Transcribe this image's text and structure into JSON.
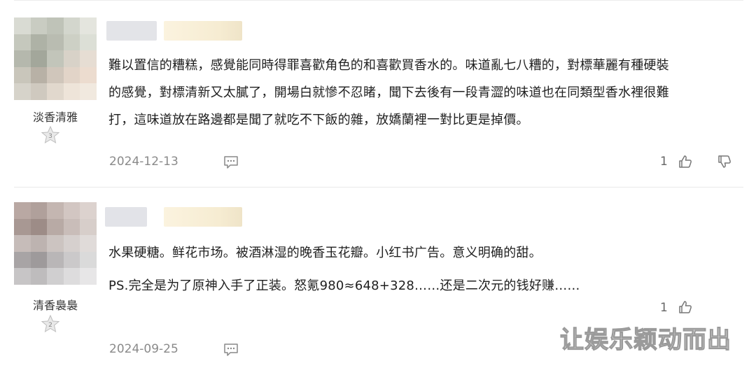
{
  "comments": [
    {
      "username": "淡香清雅",
      "level": "3",
      "text_lines": [
        "難以置信的糟糕，感覺能同時得罪喜歡角色的和喜歡買香水的。味道亂七八糟的，對標華麗有種硬裝",
        "的感覺，對標清新又太膩了，開場白就慘不忍睹，聞下去後有一段青澀的味道也在同類型香水裡很難",
        "打，這味道放在路邊都是聞了就吃不下飯的雜，放嬌蘭裡一對比更是掉價。"
      ],
      "date": "2024-12-13",
      "likes": "1"
    },
    {
      "username": "清香裊裊",
      "level": "2",
      "text_lines": [
        "水果硬糖。鲜花市场。被酒淋湿的晚香玉花瓣。小红书广告。意义明确的甜。",
        "PS.完全是为了原神入手了正装。怒氪980≈648+328……还是二次元的钱好赚……"
      ],
      "date": "2024-09-25",
      "likes": "1"
    }
  ],
  "icons": {
    "reply": "comment-icon",
    "like": "thumbs-up-icon",
    "dislike": "thumbs-down-icon",
    "level": "star-badge-icon"
  },
  "watermark": "让娱乐颖动而出",
  "colors": {
    "text": "#1f1f1f",
    "meta": "#8a8a8a",
    "divider": "#e9e9e9"
  }
}
